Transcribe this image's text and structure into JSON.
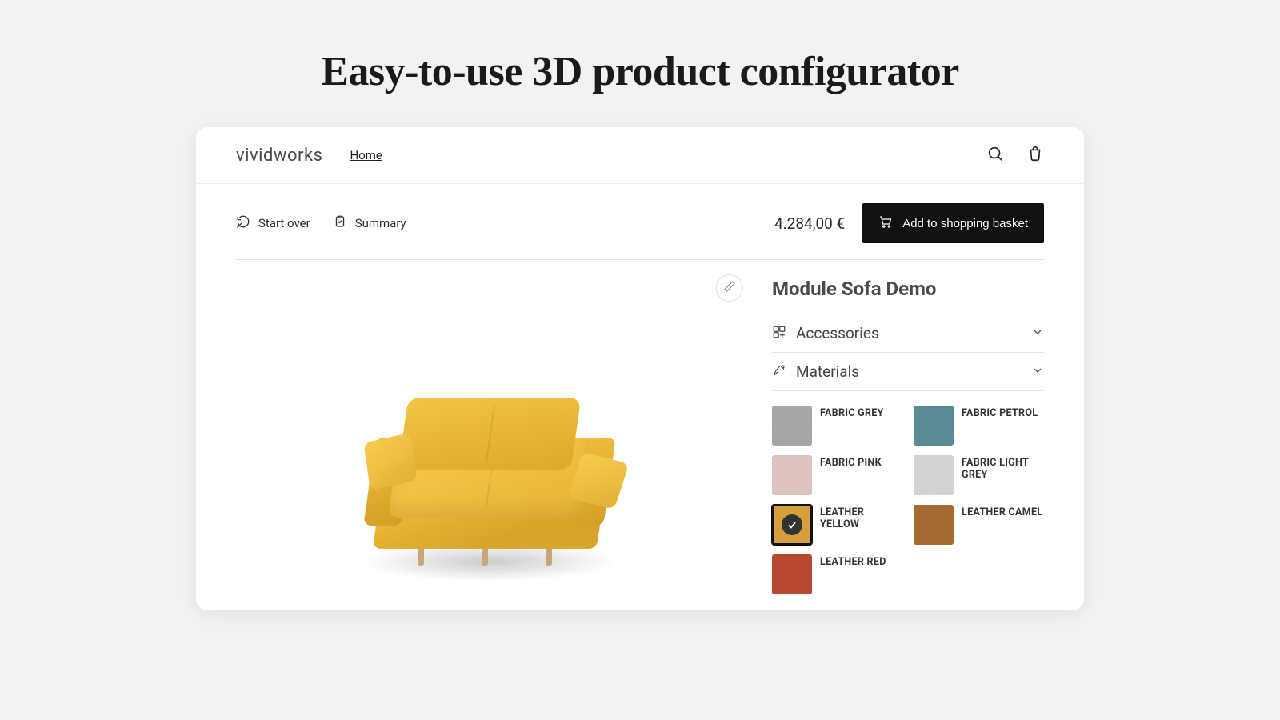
{
  "page": {
    "headline": "Easy-to-use 3D product configurator"
  },
  "topbar": {
    "brand": "vividworks",
    "home": "Home"
  },
  "configbar": {
    "start_over": "Start over",
    "summary": "Summary",
    "price": "4.284,00 €",
    "add_basket": "Add to shopping basket"
  },
  "product": {
    "title": "Module Sofa Demo",
    "sections": {
      "accessories": "Accessories",
      "materials": "Materials"
    },
    "swatches": [
      {
        "id": "fabric-grey",
        "label": "FABRIC GREY",
        "color": "#a8a8a8",
        "selected": false,
        "texture": true
      },
      {
        "id": "fabric-petrol",
        "label": "FABRIC PETROL",
        "color": "#5b8d96",
        "selected": false,
        "texture": true
      },
      {
        "id": "fabric-pink",
        "label": "FABRIC PINK",
        "color": "#e1c6c2",
        "selected": false,
        "texture": true
      },
      {
        "id": "fabric-light-grey",
        "label": "FABRIC LIGHT GREY",
        "color": "#d6d6d4",
        "selected": false,
        "texture": true
      },
      {
        "id": "leather-yellow",
        "label": "LEATHER YELLOW",
        "color": "#d6a038",
        "selected": true,
        "texture": false
      },
      {
        "id": "leather-camel",
        "label": "LEATHER CAMEL",
        "color": "#a66a33",
        "selected": false,
        "texture": false
      },
      {
        "id": "leather-red",
        "label": "LEATHER RED",
        "color": "#b9482e",
        "selected": false,
        "texture": false
      }
    ]
  }
}
